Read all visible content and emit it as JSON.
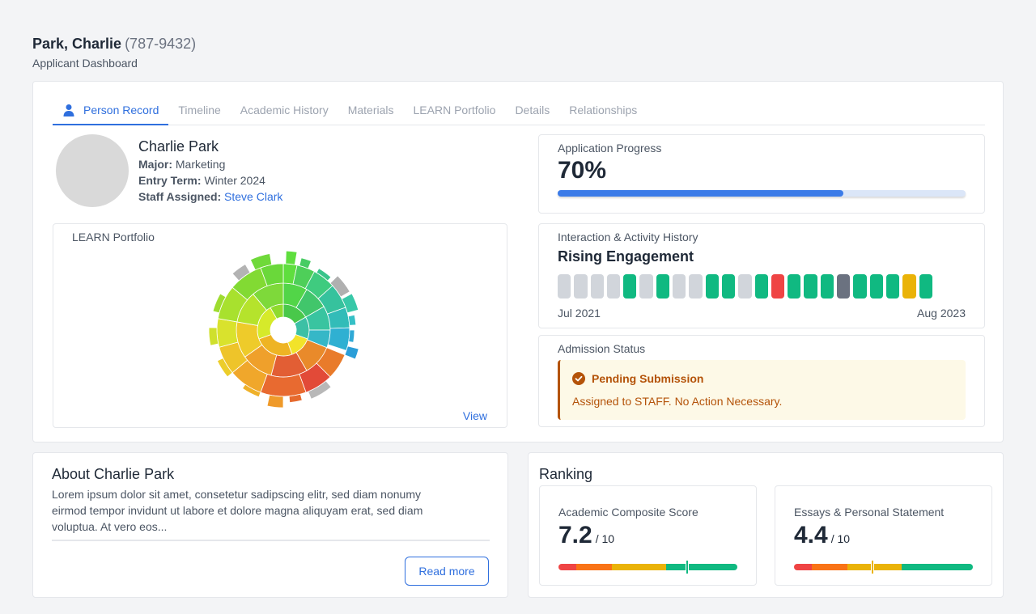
{
  "header": {
    "name": "Park, Charlie",
    "phone": "(787-9432)",
    "subtitle": "Applicant Dashboard"
  },
  "tabs": [
    {
      "label": "Person Record",
      "active": true,
      "icon": "person-icon"
    },
    {
      "label": "Timeline"
    },
    {
      "label": "Academic History"
    },
    {
      "label": "Materials"
    },
    {
      "label": "LEARN Portfolio"
    },
    {
      "label": "Details"
    },
    {
      "label": "Relationships"
    }
  ],
  "person": {
    "name": "Charlie Park",
    "major_label": "Major:",
    "major": "Marketing",
    "entry_label": "Entry Term:",
    "entry": "Winter 2024",
    "staff_label": "Staff Assigned:",
    "staff": "Steve Clark"
  },
  "learn": {
    "label": "LEARN Portfolio",
    "view": "View"
  },
  "progress": {
    "label": "Application Progress",
    "value_text": "70%",
    "value": 0.7,
    "fill_color": "#3b7be8"
  },
  "activity": {
    "label": "Interaction & Activity History",
    "title": "Rising Engagement",
    "start": "Jul 2021",
    "end": "Aug 2023",
    "cells": [
      "gray",
      "gray",
      "gray",
      "gray",
      "green",
      "gray",
      "green",
      "gray",
      "gray",
      "green",
      "green",
      "gray",
      "green",
      "red",
      "green",
      "green",
      "green",
      "dark",
      "green",
      "green",
      "green",
      "yellow",
      "green"
    ],
    "colors": {
      "gray": "#d1d5db",
      "green": "#10b981",
      "red": "#ef4444",
      "dark": "#6b7280",
      "yellow": "#eab308"
    }
  },
  "status": {
    "label": "Admission Status",
    "title": "Pending Submission",
    "message": "Assigned to STAFF. No Action Necessary.",
    "color": "#b45309"
  },
  "about": {
    "title": "About Charlie Park",
    "text": "Lorem ipsum dolor sit amet, consetetur sadipscing elitr, sed diam nonumy eirmod tempor invidunt ut labore et dolore magna aliquyam erat, sed diam voluptua. At vero eos...",
    "read_more": "Read more"
  },
  "ranking": {
    "title": "Ranking",
    "scores": [
      {
        "label": "Academic Composite Score",
        "value": "7.2",
        "max": "/ 10",
        "score": 7.2
      },
      {
        "label": "Essays & Personal Statement",
        "value": "4.4",
        "max": "/ 10",
        "score": 4.4
      }
    ],
    "scale_colors": [
      "#ef4444",
      "#f97316",
      "#eab308",
      "#10b981"
    ]
  }
}
